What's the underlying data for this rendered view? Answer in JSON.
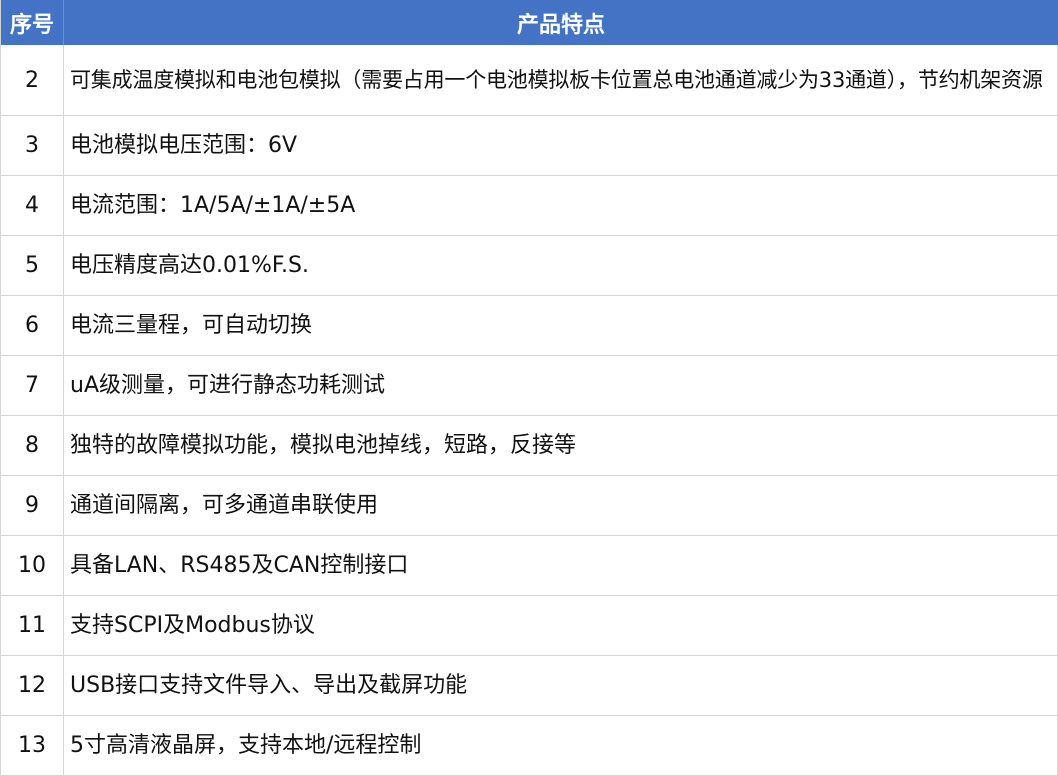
{
  "header": {
    "number": "序号",
    "feature": "产品特点"
  },
  "rows": [
    {
      "num": "2",
      "text": "可集成温度模拟和电池包模拟（需要占用一个电池模拟板卡位置总电池通道减少为33通道），节约机架资源"
    },
    {
      "num": "3",
      "text": "电池模拟电压范围：6V"
    },
    {
      "num": "4",
      "text": "电流范围：1A/5A/±1A/±5A"
    },
    {
      "num": "5",
      "text": "电压精度高达0.01%F.S."
    },
    {
      "num": "6",
      "text": "电流三量程，可自动切换"
    },
    {
      "num": "7",
      "text": "uA级测量，可进行静态功耗测试"
    },
    {
      "num": "8",
      "text": "独特的故障模拟功能，模拟电池掉线，短路，反接等"
    },
    {
      "num": "9",
      "text": "通道间隔离，可多通道串联使用"
    },
    {
      "num": "10",
      "text": "具备LAN、RS485及CAN控制接口"
    },
    {
      "num": "11",
      "text": "支持SCPI及Modbus协议"
    },
    {
      "num": "12",
      "text": "USB接口支持文件导入、导出及截屏功能"
    },
    {
      "num": "13",
      "text": "5寸高清液晶屏，支持本地/远程控制"
    }
  ]
}
